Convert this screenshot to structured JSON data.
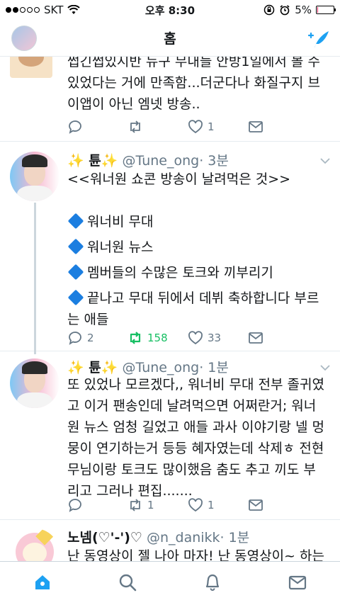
{
  "status_bar": {
    "carrier": "SKT",
    "time": "오후 8:30",
    "battery": "5%",
    "battery_level": 0.05
  },
  "nav": {
    "title": "홈"
  },
  "tweets": [
    {
      "text_lines": [
        "쩝긴쩝있시반 뉴구 무내들 안방1일에서 볼 수",
        "있었다는 거에 만족함...더군다나 화질구지 브",
        "이앱이 아닌 엠넷 방송.."
      ],
      "replies": "",
      "retweets": "",
      "likes": "1"
    },
    {
      "name": "✨ 튠✨",
      "handle": "@Tune_ong",
      "time": "· 3분",
      "text_lines": [
        "<<워너원 쇼콘 방송이 날려먹은 것>>",
        "",
        "워너비 무대",
        "워너원 뉴스",
        "멤버들의 수많은 토크와 끼부리기",
        "끝나고 무대 뒤에서 데뷔 축하합니다 부르",
        "는 애들"
      ],
      "replies": "2",
      "retweets": "158",
      "likes": "33"
    },
    {
      "name": "✨ 튠✨",
      "handle": "@Tune_ong",
      "time": "· 1분",
      "text_lines": [
        "또 있었나 모르겠다,, 워너비 무대 전부 졸귀였",
        "고 이거 팬송인데 날려먹으면 어쩌란거; 워너",
        "원 뉴스 엄청 길었고 애들 과사 이야기랑 넬 멍",
        "뭉이 연기하는거 등등 혜자였는데 삭제ㅎ 전현",
        "무님이랑 토크도 많이했음 춤도 추고 끼도 부",
        "리고 그러나 편집......."
      ],
      "replies": "",
      "retweets": "1",
      "likes": "1"
    },
    {
      "name": "노넴(♡'-')♡",
      "handle": "@n_danikk",
      "time": "· 1분",
      "text_lines": [
        "난 동영상이 젤 나아 마자! 난 동영상이~ 하는"
      ]
    }
  ],
  "tabbar": [
    "home-tab",
    "search-tab",
    "notifications-tab",
    "messages-tab"
  ],
  "colors": {
    "accent": "#1da1f2",
    "retweet_active": "#17bf63",
    "muted": "#657786",
    "diamond": "#1b7ee0"
  }
}
